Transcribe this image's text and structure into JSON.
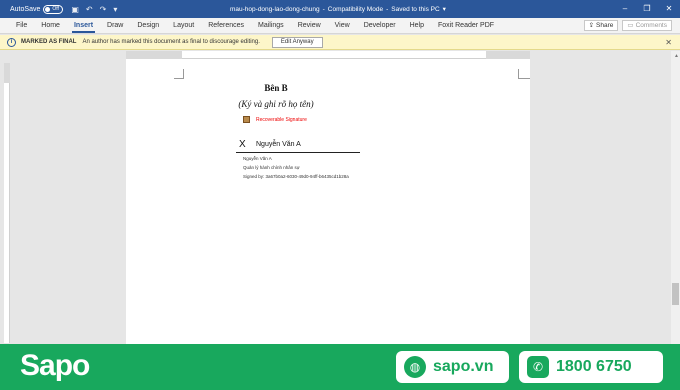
{
  "titlebar": {
    "autosave_label": "AutoSave",
    "autosave_state": "Off",
    "doc_name": "mau-hop-dong-lao-dong-chung",
    "mode": "Compatibility Mode",
    "save_status": "Saved to this PC"
  },
  "ribbon": {
    "tabs": [
      "File",
      "Home",
      "Insert",
      "Draw",
      "Design",
      "Layout",
      "References",
      "Mailings",
      "Review",
      "View",
      "Developer",
      "Help",
      "Foxit Reader PDF"
    ],
    "active_tab": "Insert",
    "share_label": "Share",
    "comments_label": "Comments"
  },
  "messagebar": {
    "title": "MARKED AS FINAL",
    "text": "An author has marked this document as final to discourage editing.",
    "button": "Edit Anyway"
  },
  "document": {
    "party_title": "Bên B",
    "party_subtitle": "(Ký và ghi rõ họ tên)",
    "recoverable_signature": "Recoverable Signature",
    "signature_x": "X",
    "signer_name": "Nguyễn Văn A",
    "detail_name": "Nguyễn Văn A",
    "detail_role": "Quản lý hành chính nhân sự",
    "detail_signed_by": "Signed by: 3a67b0a2-6030-49d0-94ff-b6435cd1b28a"
  },
  "banner": {
    "logo": "Sapo",
    "website": "sapo.vn",
    "phone": "1800 6750",
    "color": "#18a85d"
  }
}
